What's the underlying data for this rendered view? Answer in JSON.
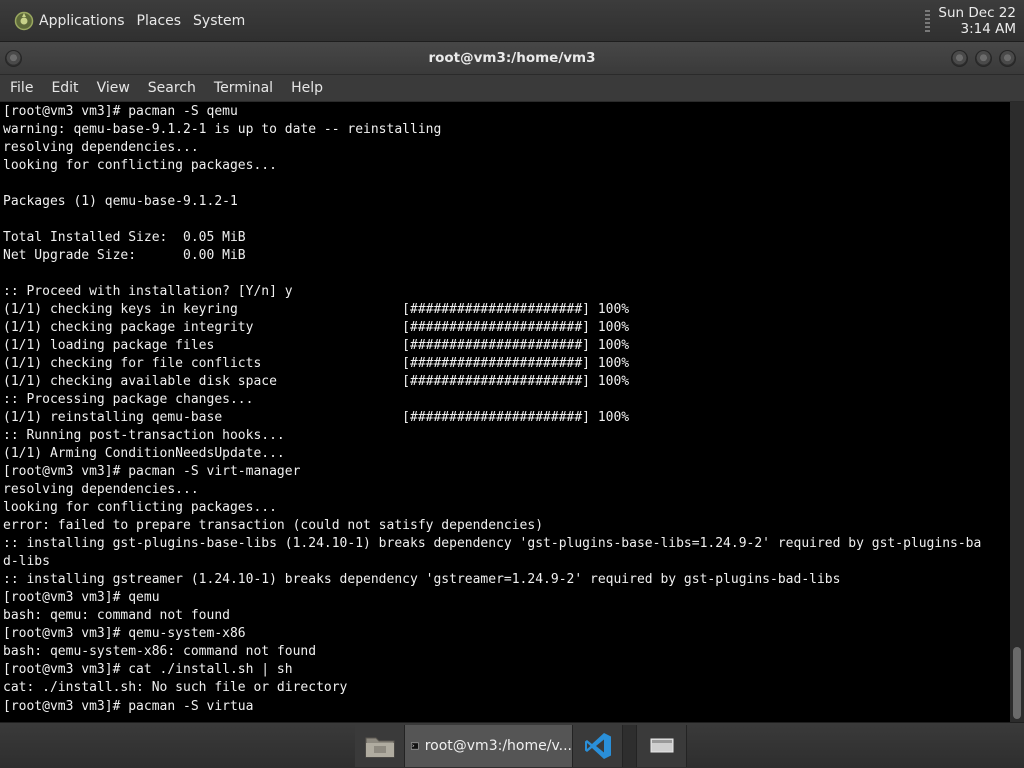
{
  "top_panel": {
    "menus": [
      "Applications",
      "Places",
      "System"
    ],
    "clock": {
      "date": "Sun Dec 22",
      "time": "3:14 AM"
    }
  },
  "window": {
    "title": "root@vm3:/home/vm3",
    "menu": [
      "File",
      "Edit",
      "View",
      "Search",
      "Terminal",
      "Help"
    ]
  },
  "terminal": {
    "lines": [
      "[root@vm3 vm3]# pacman -S qemu",
      "warning: qemu-base-9.1.2-1 is up to date -- reinstalling",
      "resolving dependencies...",
      "looking for conflicting packages...",
      "",
      "Packages (1) qemu-base-9.1.2-1",
      "",
      "Total Installed Size:  0.05 MiB",
      "Net Upgrade Size:      0.00 MiB",
      "",
      ":: Proceed with installation? [Y/n] y",
      "(1/1) checking keys in keyring                     [######################] 100%",
      "(1/1) checking package integrity                   [######################] 100%",
      "(1/1) loading package files                        [######################] 100%",
      "(1/1) checking for file conflicts                  [######################] 100%",
      "(1/1) checking available disk space                [######################] 100%",
      ":: Processing package changes...",
      "(1/1) reinstalling qemu-base                       [######################] 100%",
      ":: Running post-transaction hooks...",
      "(1/1) Arming ConditionNeedsUpdate...",
      "[root@vm3 vm3]# pacman -S virt-manager",
      "resolving dependencies...",
      "looking for conflicting packages...",
      "error: failed to prepare transaction (could not satisfy dependencies)",
      ":: installing gst-plugins-base-libs (1.24.10-1) breaks dependency 'gst-plugins-base-libs=1.24.9-2' required by gst-plugins-ba",
      "d-libs",
      ":: installing gstreamer (1.24.10-1) breaks dependency 'gstreamer=1.24.9-2' required by gst-plugins-bad-libs",
      "[root@vm3 vm3]# qemu",
      "bash: qemu: command not found",
      "[root@vm3 vm3]# qemu-system-x86",
      "bash: qemu-system-x86: command not found",
      "[root@vm3 vm3]# cat ./install.sh | sh",
      "cat: ./install.sh: No such file or directory",
      "[root@vm3 vm3]# pacman -S virtua"
    ]
  },
  "taskbar": {
    "terminal_task_label": "root@vm3:/home/v..."
  },
  "icons": {
    "app_logo": "gear-logo-icon",
    "files": "folder-icon",
    "terminal": "terminal-icon",
    "vscode": "vscode-icon",
    "desktop": "show-desktop-icon"
  },
  "colors": {
    "terminal_bg": "#000000",
    "terminal_fg": "#f0f0f0",
    "panel_bg": "#333333",
    "vscode_blue": "#2a8fd8"
  }
}
